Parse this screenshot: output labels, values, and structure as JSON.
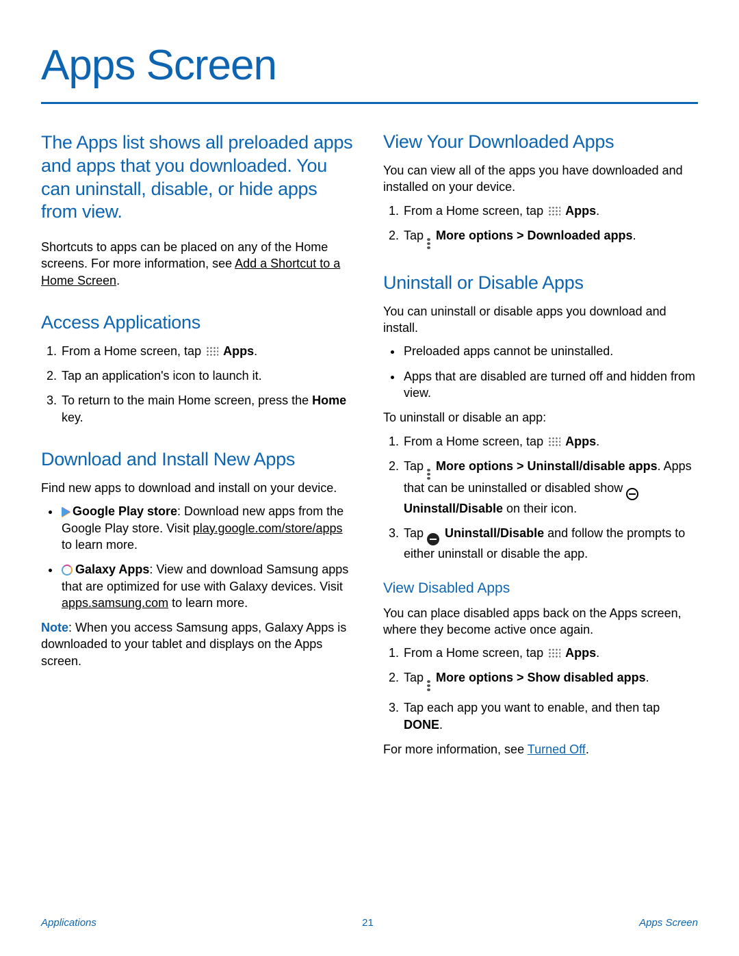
{
  "title": "Apps Screen",
  "lead": "The Apps list shows all preloaded apps and apps that you downloaded. You can uninstall, disable, or hide apps from view.",
  "shortcut_text_1": "Shortcuts to apps can be placed on any of the Home screens. For more information, see ",
  "shortcut_link": "Add a Shortcut to a Home Screen",
  "sections": {
    "access": {
      "heading": "Access Applications",
      "step1_a": "From a Home screen, tap ",
      "step1_b": "Apps",
      "step2": "Tap an application's icon to launch it.",
      "step3_a": "To return to the main Home screen, press the ",
      "step3_b": "Home",
      "step3_c": " key."
    },
    "download": {
      "heading": "Download and Install New Apps",
      "intro": "Find new apps to download and install on your device.",
      "play_bold": "Google Play store",
      "play_text": ": Download new apps from the Google Play store. Visit ",
      "play_link": "play.google.com/store/apps",
      "play_after": " to learn more.",
      "galaxy_bold": "Galaxy Apps",
      "galaxy_text": ": View and download Samsung apps that are optimized for use with Galaxy devices. Visit ",
      "galaxy_link": "apps.samsung.com",
      "galaxy_after": " to learn more.",
      "note_label": "Note",
      "note_text": ": When you access Samsung apps, Galaxy Apps is downloaded to your tablet and displays on the Apps screen."
    },
    "view_downloaded": {
      "heading": "View Your Downloaded Apps",
      "intro": "You can view all of the apps you have downloaded and installed on your device.",
      "step1_a": "From a Home screen, tap ",
      "step1_b": "Apps",
      "step2_a": "Tap ",
      "step2_b": "More options > Downloaded apps"
    },
    "uninstall": {
      "heading": "Uninstall or Disable Apps",
      "intro": "You can uninstall or disable apps you download and install.",
      "bullet1": "Preloaded apps cannot be uninstalled.",
      "bullet2": "Apps that are disabled are turned off and hidden from view.",
      "to_text": "To uninstall or disable an app:",
      "step1_a": "From a Home screen, tap ",
      "step1_b": "Apps",
      "step2_a": "Tap ",
      "step2_b": "More options > Uninstall/disable apps",
      "step2_c": ". Apps that can be uninstalled or disabled show ",
      "step2_d": "Uninstall/Disable",
      "step2_e": " on their icon.",
      "step3_a": "Tap ",
      "step3_b": "Uninstall/Disable",
      "step3_c": " and follow the prompts to either uninstall or disable the app."
    },
    "view_disabled": {
      "heading": "View Disabled Apps",
      "intro": "You can place disabled apps back on the Apps screen, where they become active once again.",
      "step1_a": "From a Home screen, tap ",
      "step1_b": "Apps",
      "step2_a": "Tap ",
      "step2_b": "More options > Show disabled apps",
      "step3_a": "Tap each app you want to enable, and then tap ",
      "step3_b": "DONE",
      "more_info_a": "For more information, see ",
      "more_info_link": "Turned Off"
    }
  },
  "footer": {
    "left": "Applications",
    "page": "21",
    "right": "Apps Screen"
  }
}
